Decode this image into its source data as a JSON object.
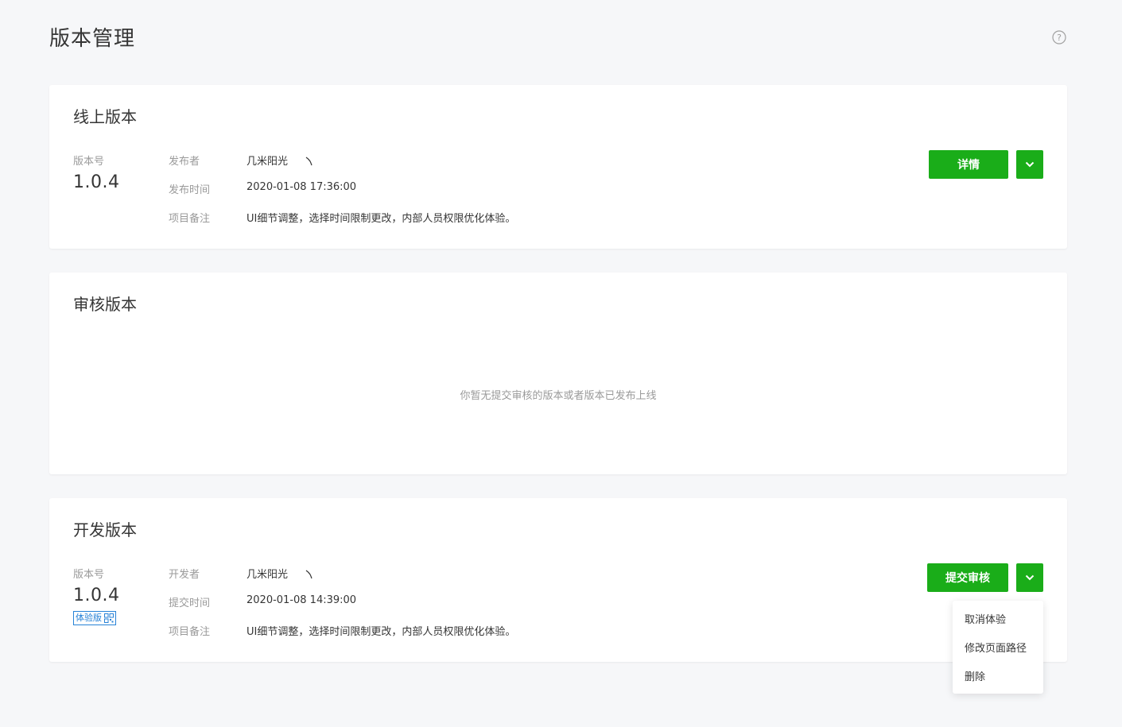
{
  "header": {
    "title": "版本管理",
    "help_icon": "question-circle-icon"
  },
  "online": {
    "title": "线上版本",
    "version_label": "版本号",
    "version": "1.0.4",
    "publisher_label": "发布者",
    "publisher": "几米阳光",
    "time_label": "发布时间",
    "time": "2020-01-08 17:36:00",
    "note_label": "项目备注",
    "note": "UI细节调整，选择时间限制更改，内部人员权限优化体验。",
    "detail_button": "详情"
  },
  "review": {
    "title": "审核版本",
    "empty_text": "你暂无提交审核的版本或者版本已发布上线"
  },
  "dev": {
    "title": "开发版本",
    "version_label": "版本号",
    "version": "1.0.4",
    "tag": "体验版",
    "developer_label": "开发者",
    "developer": "几米阳光",
    "time_label": "提交时间",
    "time": "2020-01-08 14:39:00",
    "note_label": "项目备注",
    "note": "UI细节调整，选择时间限制更改，内部人员权限优化体验。",
    "submit_button": "提交审核",
    "menu": [
      "取消体验",
      "修改页面路径",
      "删除"
    ]
  },
  "colors": {
    "primary": "#1aad19",
    "tag_blue": "#2782d7",
    "background": "#f6f7f9"
  }
}
